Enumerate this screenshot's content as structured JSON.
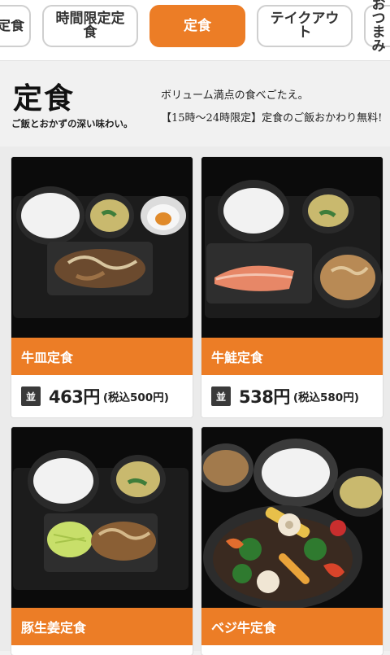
{
  "tabs": [
    {
      "label": "朝定食"
    },
    {
      "label": "時間限定定食"
    },
    {
      "label": "定食",
      "active": true
    },
    {
      "label": "テイクアウト"
    },
    {
      "label": "おつまみ"
    }
  ],
  "header": {
    "title": "定食",
    "subtitle": "ご飯とおかずの深い味わい。",
    "desc_line1": "ボリューム満点の食べごたえ。",
    "desc_line2": "【15時〜24時限定】定食のご飯おかわり無料!"
  },
  "accent_color": "#ec7d26",
  "menu_items": [
    {
      "name": "牛皿定食",
      "size": "並",
      "price": "463円",
      "tax_price": "(税込500円)"
    },
    {
      "name": "牛鮭定食",
      "size": "並",
      "price": "538円",
      "tax_price": "(税込580円)"
    },
    {
      "name": "豚生姜定食"
    },
    {
      "name": "ベジ牛定食"
    }
  ]
}
